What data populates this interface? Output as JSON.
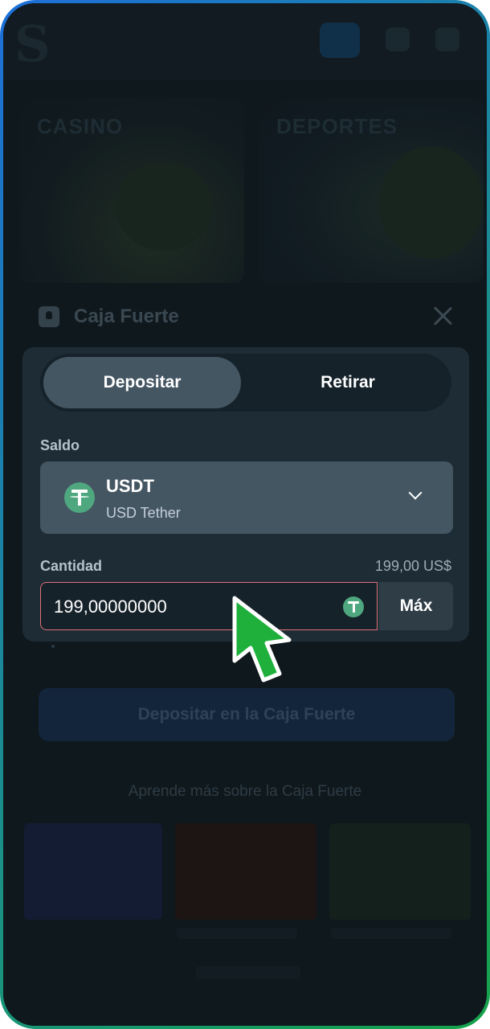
{
  "background": {
    "categories": [
      "CASINO",
      "DEPORTES"
    ]
  },
  "vault": {
    "title": "Caja Fuerte",
    "tabs": [
      "Depositar",
      "Retirar"
    ],
    "active_tab": "Depositar",
    "balance_label": "Saldo",
    "currency": {
      "code": "USDT",
      "name": "USD Tether",
      "icon": "tether-icon"
    },
    "amount_label": "Cantidad",
    "amount_value_display": "199,00 US$",
    "amount_input_value": "199,00000000",
    "max_label": "Máx",
    "deposit_button_label": "Depositar en la Caja Fuerte",
    "learn_more_label": "Aprende más sobre la Caja Fuerte"
  },
  "colors": {
    "accent_border": "#e07079",
    "tether_green": "#4fa77f",
    "cursor_green": "#1fb03c",
    "frame_gradient_start": "#1d6fd8",
    "frame_gradient_end": "#16a34a"
  }
}
